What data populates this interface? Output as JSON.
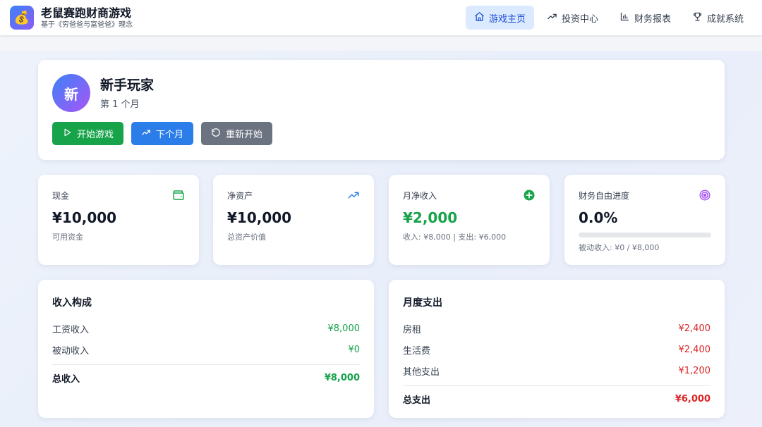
{
  "app": {
    "logo_icon": "money-bag-icon",
    "title": "老鼠赛跑财商游戏",
    "subtitle": "基于《穷爸爸与富爸爸》理念"
  },
  "nav": {
    "items": [
      {
        "label": "游戏主页",
        "icon": "home-icon",
        "active": true
      },
      {
        "label": "投资中心",
        "icon": "trending-up-icon",
        "active": false
      },
      {
        "label": "财务报表",
        "icon": "bar-chart-icon",
        "active": false
      },
      {
        "label": "成就系统",
        "icon": "trophy-icon",
        "active": false
      }
    ]
  },
  "player": {
    "avatar_text": "新",
    "name": "新手玩家",
    "month": "第 1 个月"
  },
  "actions": {
    "start": "开始游戏",
    "next_month": "下个月",
    "restart": "重新开始"
  },
  "stats": {
    "cash": {
      "label": "现金",
      "value": "¥10,000",
      "sub": "可用资金",
      "icon": "wallet-icon"
    },
    "net_worth": {
      "label": "净资产",
      "value": "¥10,000",
      "sub": "总资产价值",
      "icon": "trending-up-icon"
    },
    "monthly_net": {
      "label": "月净收入",
      "value": "¥2,000",
      "sub": "收入: ¥8,000 | 支出: ¥6,000",
      "icon": "plus-circle-icon"
    },
    "freedom": {
      "label": "财务自由进度",
      "value": "0.0%",
      "progress": 0.0,
      "sub": "被动收入: ¥0 / ¥8,000",
      "icon": "target-icon"
    }
  },
  "income": {
    "title": "收入构成",
    "rows": [
      {
        "label": "工资收入",
        "amount": "¥8,000"
      },
      {
        "label": "被动收入",
        "amount": "¥0"
      }
    ],
    "total_label": "总收入",
    "total_amount": "¥8,000"
  },
  "expenses": {
    "title": "月度支出",
    "rows": [
      {
        "label": "房租",
        "amount": "¥2,400"
      },
      {
        "label": "生活费",
        "amount": "¥2,400"
      },
      {
        "label": "其他支出",
        "amount": "¥1,200"
      }
    ],
    "total_label": "总支出",
    "total_amount": "¥6,000"
  },
  "colors": {
    "accent_blue": "#2b7de9",
    "positive_green": "#16a34a",
    "negative_red": "#dc2626",
    "neutral_gray": "#6b7280",
    "progress_purple": "#8b5cf6"
  }
}
